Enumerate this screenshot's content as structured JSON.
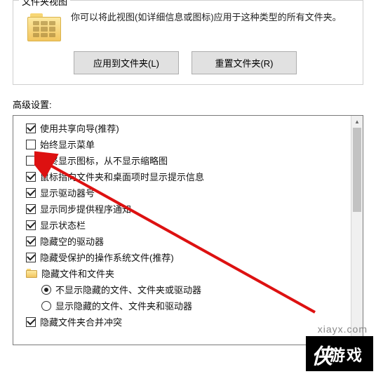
{
  "panel": {
    "title": "文件夹视图",
    "description": "你可以将此视图(如详细信息或图标)应用于这种类型的所有文件夹。",
    "applyButton": "应用到文件夹(L)",
    "resetButton": "重置文件夹(R)"
  },
  "advanced": {
    "label": "高级设置:",
    "items": [
      {
        "type": "checkbox",
        "checked": true,
        "label": "使用共享向导(推荐)"
      },
      {
        "type": "checkbox",
        "checked": false,
        "label": "始终显示菜单"
      },
      {
        "type": "checkbox",
        "checked": false,
        "label": "始终显示图标，从不显示缩略图"
      },
      {
        "type": "checkbox",
        "checked": true,
        "label": "鼠标指向文件夹和桌面项时显示提示信息"
      },
      {
        "type": "checkbox",
        "checked": true,
        "label": "显示驱动器号"
      },
      {
        "type": "checkbox",
        "checked": true,
        "label": "显示同步提供程序通知"
      },
      {
        "type": "checkbox",
        "checked": true,
        "label": "显示状态栏"
      },
      {
        "type": "checkbox",
        "checked": true,
        "label": "隐藏空的驱动器"
      },
      {
        "type": "checkbox",
        "checked": true,
        "label": "隐藏受保护的操作系统文件(推荐)"
      },
      {
        "type": "folder",
        "label": "隐藏文件和文件夹"
      },
      {
        "type": "radio",
        "indent": true,
        "checked": true,
        "label": "不显示隐藏的文件、文件夹或驱动器"
      },
      {
        "type": "radio",
        "indent": true,
        "checked": false,
        "label": "显示隐藏的文件、文件夹和驱动器"
      },
      {
        "type": "checkbox",
        "checked": true,
        "label": "隐藏文件夹合并冲突"
      }
    ]
  },
  "watermark": {
    "url": "xiayx.com",
    "text": "游戏"
  }
}
